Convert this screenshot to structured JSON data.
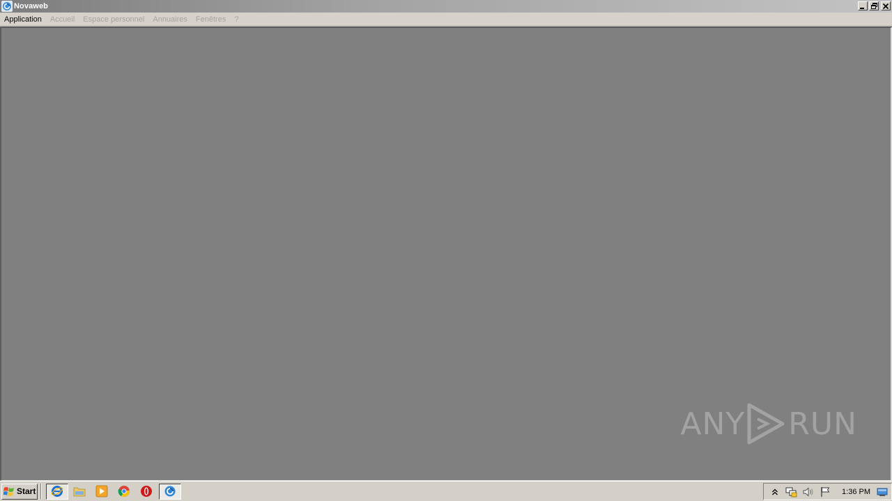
{
  "window": {
    "title": "Novaweb",
    "icon": "novaweb-app-icon",
    "controls": [
      "minimize",
      "restore",
      "close"
    ]
  },
  "menu": {
    "items": [
      {
        "label": "Application",
        "enabled": true
      },
      {
        "label": "Accueil",
        "enabled": false
      },
      {
        "label": "Espace personnel",
        "enabled": false
      },
      {
        "label": "Annuaires",
        "enabled": false
      },
      {
        "label": "Fenêtres",
        "enabled": false
      },
      {
        "label": "?",
        "enabled": false
      }
    ]
  },
  "watermark": {
    "left": "ANY",
    "right": "RUN"
  },
  "taskbar": {
    "start_label": "Start",
    "quick_launch": [
      "internet-explorer-icon",
      "file-explorer-icon",
      "media-player-icon",
      "chrome-icon",
      "opera-icon"
    ],
    "active_task_icon": "novaweb-app-icon",
    "tray_icons": [
      "show-hidden-icons",
      "network-icon",
      "volume-icon",
      "action-center-flag-icon"
    ],
    "clock": "1:36 PM"
  },
  "colors": {
    "client_bg": "#808080",
    "menubar_bg": "#d6d2ca",
    "menu_disabled": "#a7a39c",
    "taskbar_bg": "#d4d0c8"
  }
}
